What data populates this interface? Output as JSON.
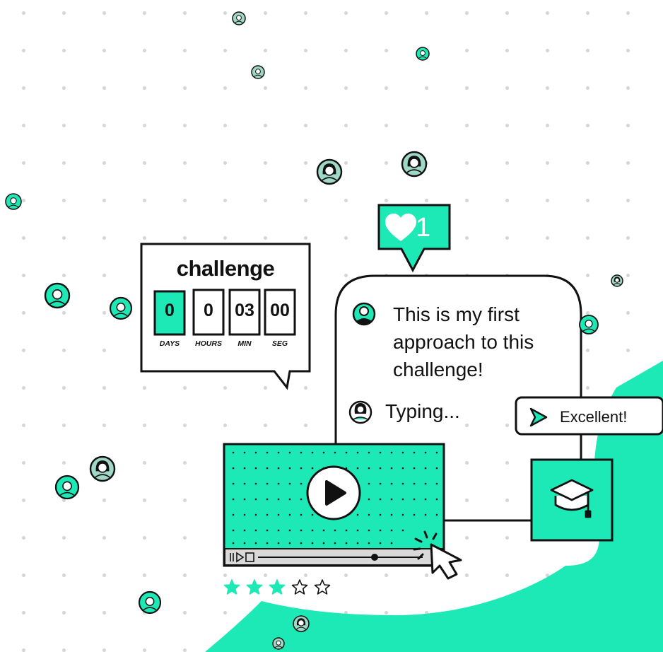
{
  "countdown": {
    "title": "challenge",
    "units": [
      {
        "value": "0",
        "label": "DAYS",
        "active": true
      },
      {
        "value": "0",
        "label": "HOURS",
        "active": false
      },
      {
        "value": "03",
        "label": "MIN",
        "active": false
      },
      {
        "value": "00",
        "label": "SEG",
        "active": false
      }
    ]
  },
  "chat": {
    "message": "This is my first approach to this challenge!",
    "typing": "Typing..."
  },
  "likes": {
    "count": "1",
    "icon": "heart-icon"
  },
  "feedback": {
    "label": "Excellent!",
    "icon": "send-arrow-icon"
  },
  "course": {
    "icon": "graduation-cap-icon"
  },
  "video": {
    "play_icon": "play-icon",
    "cursor_icon": "cursor-arrow-icon"
  },
  "rating": {
    "value": 3,
    "max": 5
  },
  "colors": {
    "accent": "#1de9b6",
    "outline": "#111111",
    "avatar_bg": "#9fd8c6"
  }
}
